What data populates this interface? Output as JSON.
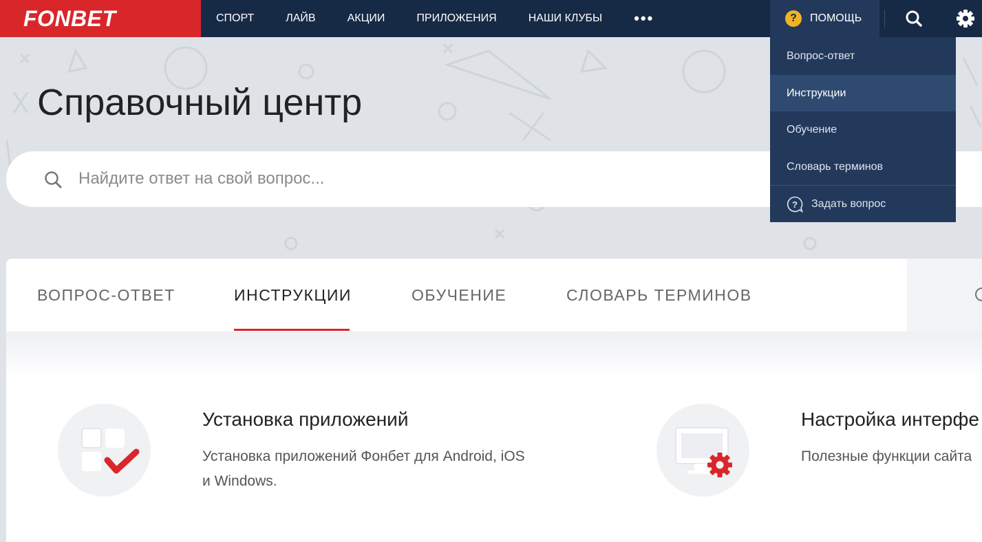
{
  "header": {
    "logo": "FONBET",
    "nav": [
      "СПОРТ",
      "ЛАЙВ",
      "АКЦИИ",
      "ПРИЛОЖЕНИЯ",
      "НАШИ КЛУБЫ"
    ],
    "more": "•••",
    "help_label": "ПОМОЩЬ",
    "help_icon": "?"
  },
  "dropdown": {
    "items": [
      "Вопрос-ответ",
      "Инструкции",
      "Обучение",
      "Словарь терминов"
    ],
    "active": "Инструкции",
    "ask": "Задать вопрос"
  },
  "hero": {
    "title": "Справочный центр",
    "search_placeholder": "Найдите ответ на свой вопрос..."
  },
  "tabs": {
    "items": [
      "ВОПРОС-ОТВЕТ",
      "ИНСТРУКЦИИ",
      "ОБУЧЕНИЕ",
      "СЛОВАРЬ ТЕРМИНОВ"
    ],
    "active": "ИНСТРУКЦИИ"
  },
  "articles": [
    {
      "title": "Установка приложений",
      "desc_line1": "Установка приложений Фонбет для Android, iOS",
      "desc_line2": "и Windows.",
      "icon": "apps-check-icon"
    },
    {
      "title": "Настройка интерфе",
      "desc_line1": "Полезные функции сайта",
      "desc_line2": "",
      "icon": "monitor-gear-icon"
    }
  ],
  "colors": {
    "brand_red": "#d9262b",
    "header_navy": "#172a45",
    "dropdown": "#22395b",
    "help_yellow": "#f0b323"
  }
}
